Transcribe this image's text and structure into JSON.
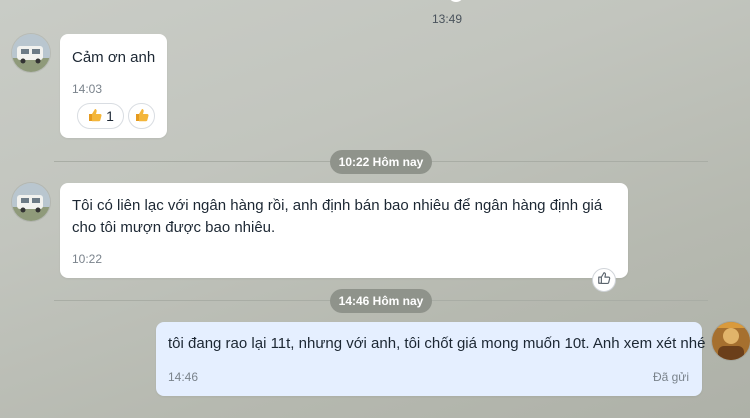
{
  "messages": [
    {
      "sender": "contact",
      "text": "Cảm ơn anh",
      "time": "14:03",
      "reactions": [
        {
          "icon": "thumbs-up-emoji",
          "count": "1"
        },
        {
          "icon": "thumbs-up-emoji",
          "count": ""
        }
      ]
    },
    {
      "sender": "contact",
      "text": "Tôi có liên lạc với ngân hàng rồi, anh định bán bao nhiêu để ngân hàng định giá cho tôi mượn được bao nhiêu.",
      "time": "10:22",
      "action_icon": "thumbs-up-outline-icon"
    },
    {
      "sender": "me",
      "text": "tôi đang rao lại 11t, nhưng với anh, tôi chốt giá mong muốn 10t. Anh xem xét nhé",
      "time": "14:46",
      "status": "Đã gửi"
    }
  ],
  "separators": {
    "top_time": "13:49",
    "date_pill_1": "10:22 Hôm nay",
    "date_pill_2": "14:46 Hôm nay"
  },
  "colors": {
    "background": "#c2c5be",
    "bubble_incoming": "#ffffff",
    "bubble_outgoing": "#e5efff",
    "date_pill": "#8f938b",
    "emoji_yellow": "#f4b63a"
  }
}
